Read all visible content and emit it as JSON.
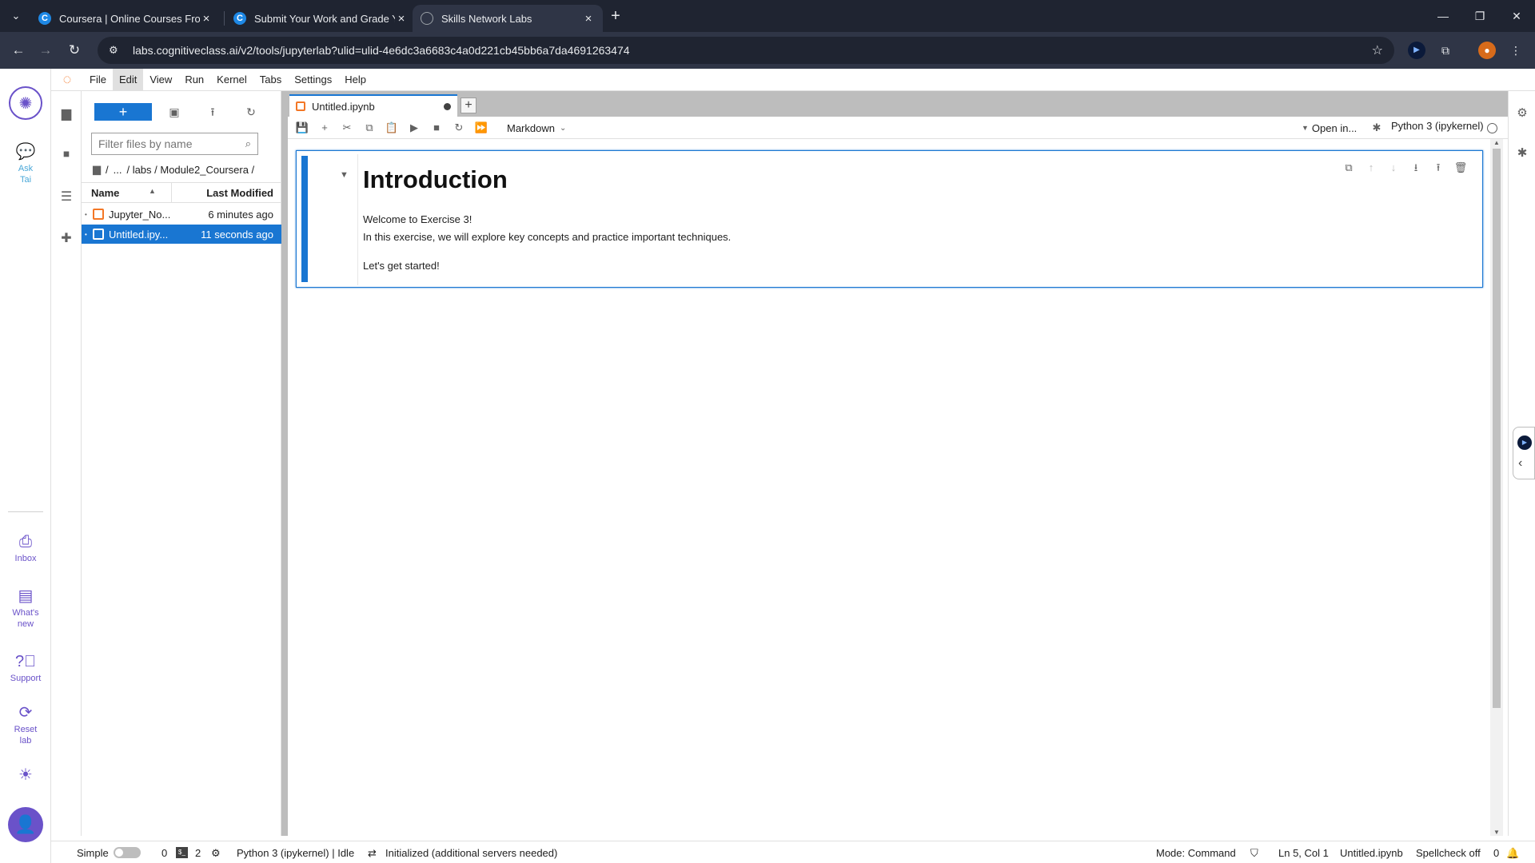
{
  "browser": {
    "tabs": [
      {
        "title": "Coursera | Online Courses From",
        "favicon": "coursera-c"
      },
      {
        "title": "Submit Your Work and Grade Y",
        "favicon": "coursera-c"
      },
      {
        "title": "Skills Network Labs",
        "favicon": "globe"
      }
    ],
    "url": "labs.cognitiveclass.ai/v2/tools/jupyterlab?ulid=ulid-4e6dc3a6683c4a0d221cb45bb6a7da4691263474"
  },
  "sn_rail": {
    "ask": "Ask Tai",
    "inbox": "Inbox",
    "whats_new": "What's new",
    "support": "Support",
    "reset": "Reset lab"
  },
  "menu": [
    "File",
    "Edit",
    "View",
    "Run",
    "Kernel",
    "Tabs",
    "Settings",
    "Help"
  ],
  "file_browser": {
    "filter_placeholder": "Filter files by name",
    "crumbs": [
      "/",
      "...",
      "/ labs / Module2_Coursera /"
    ],
    "col_name": "Name",
    "col_modified": "Last Modified",
    "files": [
      {
        "name": "Jupyter_No...",
        "modified": "6 minutes ago",
        "selected": false
      },
      {
        "name": "Untitled.ipy...",
        "modified": "11 seconds ago",
        "selected": true
      }
    ]
  },
  "notebook": {
    "tab_title": "Untitled.ipynb",
    "cell_type": "Markdown",
    "open_in": "Open in...",
    "kernel": "Python 3 (ipykernel)",
    "cell": {
      "heading": "Introduction",
      "line1": "Welcome to Exercise 3!",
      "line2": "In this exercise, we will explore key concepts and practice important techniques.",
      "line3": "Let's get started!"
    }
  },
  "status": {
    "simple": "Simple",
    "count1": "0",
    "count2": "2",
    "kernel_status": "Python 3 (ipykernel) | Idle",
    "init": "Initialized (additional servers needed)",
    "mode": "Mode: Command",
    "position": "Ln 5, Col 1",
    "file": "Untitled.ipynb",
    "spellcheck": "Spellcheck off",
    "notifications": "0"
  },
  "colors": {
    "accent": "#1976d2",
    "sn_purple": "#6a52c9",
    "chrome_dark": "#1f2431"
  }
}
